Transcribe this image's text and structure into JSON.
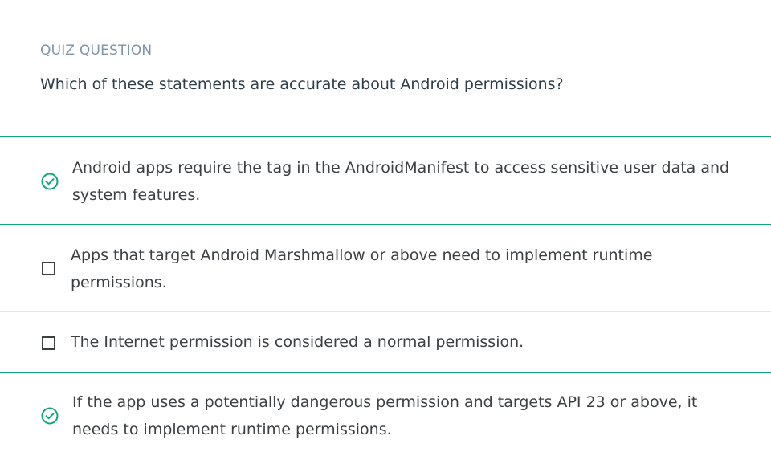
{
  "quiz": {
    "eyebrow": "QUIZ QUESTION",
    "question": "Which of these statements are accurate about Android permissions?"
  },
  "options": [
    {
      "text": "Android apps require the tag in the AndroidManifest to access sensitive user data and system features.",
      "state": "correct",
      "icon": "check-circle-icon"
    },
    {
      "text": "Apps that target Android Marshmallow or above need to implement runtime permissions.",
      "state": "unchecked",
      "icon": "checkbox-icon"
    },
    {
      "text": "The Internet permission is considered a normal permission.",
      "state": "unchecked",
      "icon": "checkbox-icon"
    },
    {
      "text": "If the app uses a potentially dangerous permission and targets API 23 or above, it needs to implement runtime permissions.",
      "state": "correct",
      "icon": "check-circle-icon"
    }
  ],
  "colors": {
    "accent": "#0aa879",
    "eyebrow": "#7d93a8",
    "text": "#3c4043",
    "divider": "#e6e6e6"
  }
}
